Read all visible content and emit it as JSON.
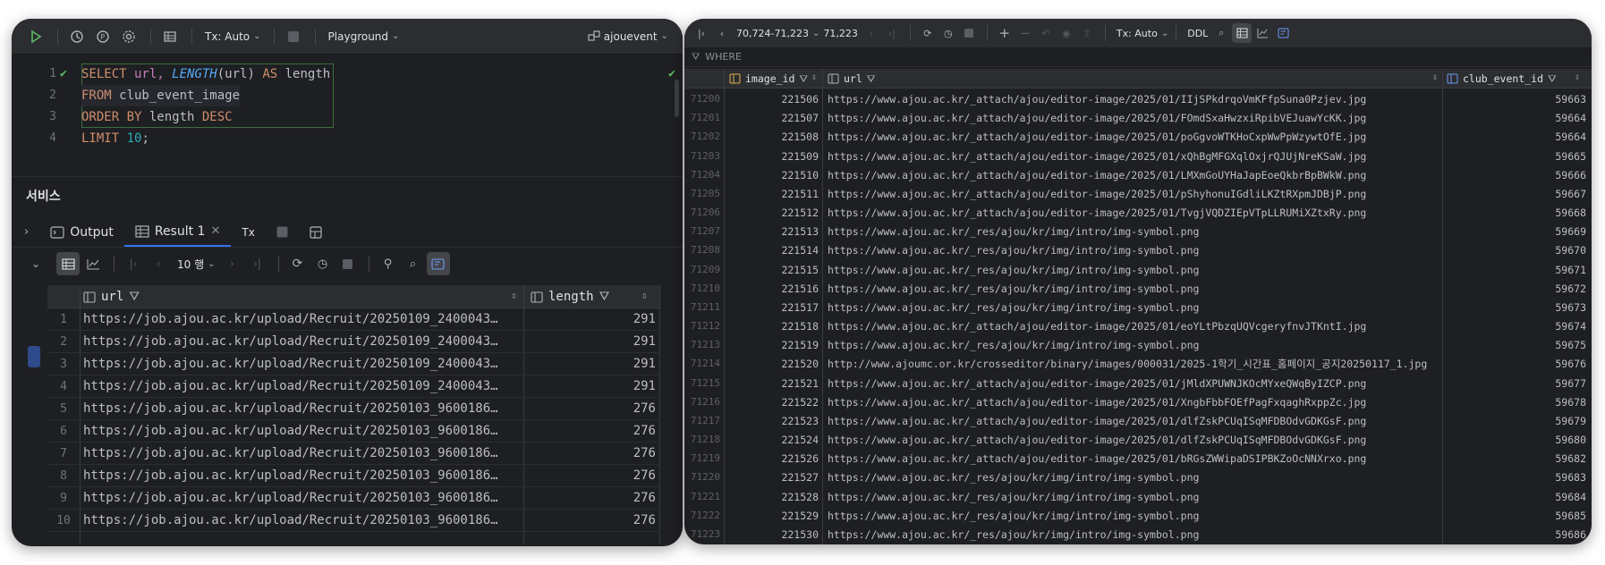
{
  "left": {
    "toolbar": {
      "tx_label": "Tx: Auto",
      "playground_label": "Playground",
      "datasource_label": "ajouevent"
    },
    "editor": {
      "line_numbers": [
        "1",
        "2",
        "3",
        "4"
      ],
      "lines": [
        {
          "kw1": "SELECT",
          "t1": " url, ",
          "fn": "LENGTH",
          "t2": "(url) ",
          "kw2": "AS",
          "t3": " length"
        },
        {
          "kw1": "FROM",
          "t1": " club_event_image"
        },
        {
          "kw1": "ORDER BY",
          "t1": " length ",
          "kw2": "DESC"
        },
        {
          "kw1": "LIMIT",
          "t1": " ",
          "num": "10",
          "t2": ";"
        }
      ]
    },
    "services_title": "서비스",
    "tabs": {
      "output_label": "Output",
      "result_label": "Result 1",
      "tx_label": "Tx"
    },
    "results_toolbar": {
      "page_size_label": "10 행"
    },
    "grid": {
      "columns": [
        "url",
        "length"
      ],
      "rows": [
        {
          "n": "1",
          "url": "https://job.ajou.ac.kr/upload/Recruit/20250109_2400043…",
          "length": "291"
        },
        {
          "n": "2",
          "url": "https://job.ajou.ac.kr/upload/Recruit/20250109_2400043…",
          "length": "291"
        },
        {
          "n": "3",
          "url": "https://job.ajou.ac.kr/upload/Recruit/20250109_2400043…",
          "length": "291"
        },
        {
          "n": "4",
          "url": "https://job.ajou.ac.kr/upload/Recruit/20250109_2400043…",
          "length": "291"
        },
        {
          "n": "5",
          "url": "https://job.ajou.ac.kr/upload/Recruit/20250103_9600186…",
          "length": "276"
        },
        {
          "n": "6",
          "url": "https://job.ajou.ac.kr/upload/Recruit/20250103_9600186…",
          "length": "276"
        },
        {
          "n": "7",
          "url": "https://job.ajou.ac.kr/upload/Recruit/20250103_9600186…",
          "length": "276"
        },
        {
          "n": "8",
          "url": "https://job.ajou.ac.kr/upload/Recruit/20250103_9600186…",
          "length": "276"
        },
        {
          "n": "9",
          "url": "https://job.ajou.ac.kr/upload/Recruit/20250103_9600186…",
          "length": "276"
        },
        {
          "n": "10",
          "url": "https://job.ajou.ac.kr/upload/Recruit/20250103_9600186…",
          "length": "276"
        }
      ]
    }
  },
  "right": {
    "toolbar": {
      "range_label": "70,724-71,223",
      "total_label": "71,223",
      "tx_label": "Tx: Auto",
      "ddl_label": "DDL"
    },
    "where_label": "WHERE",
    "columns": [
      "image_id",
      "url",
      "club_event_id"
    ],
    "rows": [
      {
        "n": "71200",
        "id": "221506",
        "url": "https://www.ajou.ac.kr/_attach/ajou/editor-image/2025/01/IIjSPkdrqoVmKFfpSuna0Pzjev.jpg",
        "cid": "59663"
      },
      {
        "n": "71201",
        "id": "221507",
        "url": "https://www.ajou.ac.kr/_attach/ajou/editor-image/2025/01/FOmdSxaHwzxiRpibVEJuawYcKK.jpg",
        "cid": "59664"
      },
      {
        "n": "71202",
        "id": "221508",
        "url": "https://www.ajou.ac.kr/_attach/ajou/editor-image/2025/01/poGgvoWTKHoCxpWwPpWzywtOfE.jpg",
        "cid": "59664"
      },
      {
        "n": "71203",
        "id": "221509",
        "url": "https://www.ajou.ac.kr/_attach/ajou/editor-image/2025/01/xQhBgMFGXqlOxjrQJUjNreKSaW.jpg",
        "cid": "59665"
      },
      {
        "n": "71204",
        "id": "221510",
        "url": "https://www.ajou.ac.kr/_attach/ajou/editor-image/2025/01/LMXmGoUYHaJapEoeQkbrBpBWkW.png",
        "cid": "59666"
      },
      {
        "n": "71205",
        "id": "221511",
        "url": "https://www.ajou.ac.kr/_attach/ajou/editor-image/2025/01/pShyhonuIGdliLKZtRXpmJDBjP.png",
        "cid": "59667"
      },
      {
        "n": "71206",
        "id": "221512",
        "url": "https://www.ajou.ac.kr/_attach/ajou/editor-image/2025/01/TvgjVQDZIEpVTpLLRUMiXZtxRy.png",
        "cid": "59668"
      },
      {
        "n": "71207",
        "id": "221513",
        "url": "https://www.ajou.ac.kr/_res/ajou/kr/img/intro/img-symbol.png",
        "cid": "59669"
      },
      {
        "n": "71208",
        "id": "221514",
        "url": "https://www.ajou.ac.kr/_res/ajou/kr/img/intro/img-symbol.png",
        "cid": "59670"
      },
      {
        "n": "71209",
        "id": "221515",
        "url": "https://www.ajou.ac.kr/_res/ajou/kr/img/intro/img-symbol.png",
        "cid": "59671"
      },
      {
        "n": "71210",
        "id": "221516",
        "url": "https://www.ajou.ac.kr/_res/ajou/kr/img/intro/img-symbol.png",
        "cid": "59672"
      },
      {
        "n": "71211",
        "id": "221517",
        "url": "https://www.ajou.ac.kr/_res/ajou/kr/img/intro/img-symbol.png",
        "cid": "59673"
      },
      {
        "n": "71212",
        "id": "221518",
        "url": "https://www.ajou.ac.kr/_attach/ajou/editor-image/2025/01/eoYLtPbzqUQVcgeryfnvJTKntI.jpg",
        "cid": "59674"
      },
      {
        "n": "71213",
        "id": "221519",
        "url": "https://www.ajou.ac.kr/_res/ajou/kr/img/intro/img-symbol.png",
        "cid": "59675"
      },
      {
        "n": "71214",
        "id": "221520",
        "url": "http://www.ajoumc.or.kr/crosseditor/binary/images/000031/2025-1학기_시간표_홈페이지_공지20250117_1.jpg",
        "cid": "59676"
      },
      {
        "n": "71215",
        "id": "221521",
        "url": "https://www.ajou.ac.kr/_attach/ajou/editor-image/2025/01/jMldXPUWNJKOcMYxeQWqByIZCP.png",
        "cid": "59677"
      },
      {
        "n": "71216",
        "id": "221522",
        "url": "https://www.ajou.ac.kr/_attach/ajou/editor-image/2025/01/XngbFbbFOEfPagFxqaghRxppZc.jpg",
        "cid": "59678"
      },
      {
        "n": "71217",
        "id": "221523",
        "url": "https://www.ajou.ac.kr/_attach/ajou/editor-image/2025/01/dlfZskPCUqISqMFDBOdvGDKGsF.png",
        "cid": "59679"
      },
      {
        "n": "71218",
        "id": "221524",
        "url": "https://www.ajou.ac.kr/_attach/ajou/editor-image/2025/01/dlfZskPCUqISqMFDBOdvGDKGsF.png",
        "cid": "59680"
      },
      {
        "n": "71219",
        "id": "221526",
        "url": "https://www.ajou.ac.kr/_attach/ajou/editor-image/2025/01/bRGsZWWipaDSIPBKZoOcNNXrxo.png",
        "cid": "59682"
      },
      {
        "n": "71220",
        "id": "221527",
        "url": "https://www.ajou.ac.kr/_res/ajou/kr/img/intro/img-symbol.png",
        "cid": "59683"
      },
      {
        "n": "71221",
        "id": "221528",
        "url": "https://www.ajou.ac.kr/_res/ajou/kr/img/intro/img-symbol.png",
        "cid": "59684"
      },
      {
        "n": "71222",
        "id": "221529",
        "url": "https://www.ajou.ac.kr/_res/ajou/kr/img/intro/img-symbol.png",
        "cid": "59685"
      },
      {
        "n": "71223",
        "id": "221530",
        "url": "https://www.ajou.ac.kr/_res/ajou/kr/img/intro/img-symbol.png",
        "cid": "59686"
      }
    ]
  },
  "colors": {
    "accent": "#3574f0",
    "run_green": "#5fb865",
    "keyword": "#cf8e6d",
    "function": "#56a8f5",
    "number": "#2aacb8"
  }
}
